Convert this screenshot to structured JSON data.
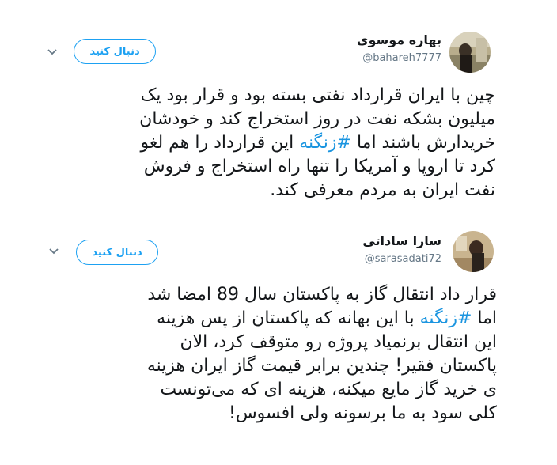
{
  "tweets": [
    {
      "author_name": "بهاره موسوی",
      "author_handle": "@bahareh7777",
      "follow_label": "دنبال کنید",
      "body_lines": [
        [
          "چین با ایران قرارداد نفتی بسته بود و قرار بود یک"
        ],
        [
          "میلیون بشکه نفت در روز استخراج کند و خودشان"
        ],
        [
          "خریدارش باشند اما ",
          "#زنگنه",
          " این قرارداد را هم لغو"
        ],
        [
          "کرد تا اروپا و آمریکا را تنها راه استخراج و فروش"
        ],
        [
          "نفت ایران به مردم معرفی کند."
        ]
      ]
    },
    {
      "author_name": "سارا ساداتی",
      "author_handle": "@sarasadati72",
      "follow_label": "دنبال کنید",
      "body_lines": [
        [
          "قرار داد انتقال گاز به پاکستان سال 89 امضا شد"
        ],
        [
          "اما ",
          "#زنگنه",
          " با این بهانه که پاکستان از پس هزینه"
        ],
        [
          "این انتقال برنمیاد پروژه رو متوقف کرد، الان"
        ],
        [
          "پاکستان فقیر! چندین برابر قیمت گاز ایران هزینه"
        ],
        [
          "ی خرید گاز مایع میکنه، هزینه ای که می‌تونست"
        ],
        [
          "کلی سود به ما برسونه ولی افسوس!"
        ]
      ]
    }
  ],
  "colors": {
    "accent": "#1da1f2",
    "hashtag": "#1b95e0",
    "muted": "#657786",
    "text": "#14171a"
  },
  "icons": {
    "caret": "chevron-down-icon"
  }
}
